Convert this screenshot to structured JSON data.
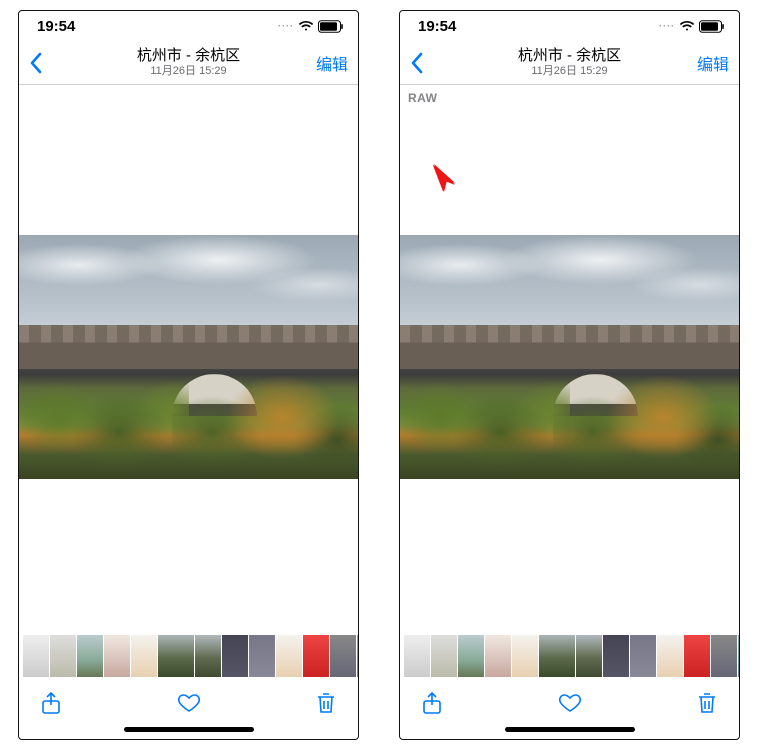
{
  "status": {
    "time": "19:54",
    "dots": "····"
  },
  "nav": {
    "title": "杭州市 - 余杭区",
    "subtitle": "11月26日 15:29",
    "edit": "编辑"
  },
  "raw_badge": "RAW",
  "colors": {
    "accent": "#007AFF"
  }
}
